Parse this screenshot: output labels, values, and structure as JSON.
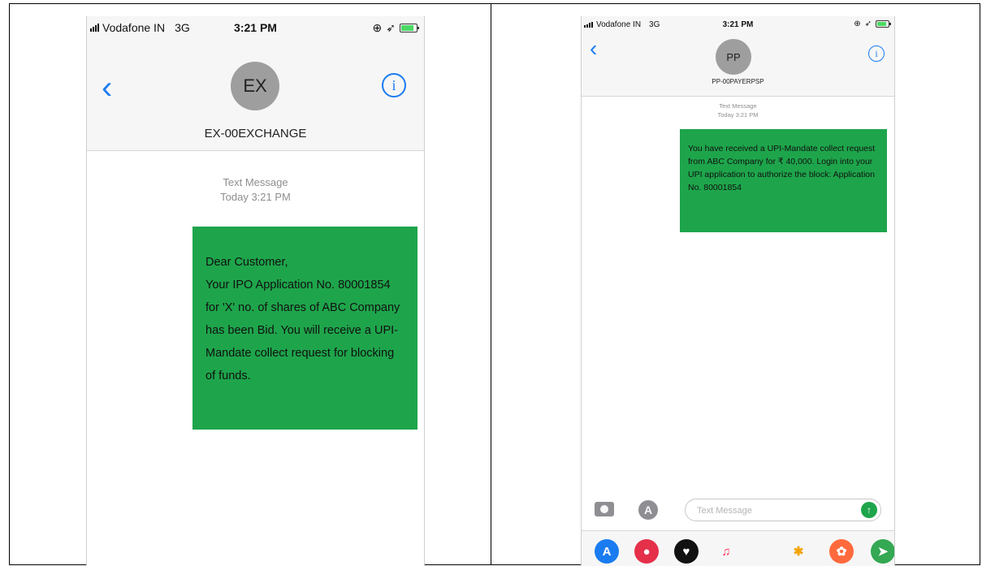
{
  "screen1": {
    "status": {
      "carrier": "Vodafone IN",
      "network": "3G",
      "time": "3:21 PM"
    },
    "contact": {
      "initials": "EX",
      "name": "EX-00EXCHANGE"
    },
    "message_meta": {
      "type": "Text Message",
      "time": "Today 3:21 PM"
    },
    "message": {
      "lines": [
        "Dear Customer,",
        "Your IPO Application No. 80001854 for 'X' no. of shares of ABC Company has been Bid. You will receive a UPI-Mandate collect request for blocking of funds."
      ],
      "bubble_color": "#1ea54b"
    }
  },
  "screen2": {
    "status": {
      "carrier": "Vodafone IN",
      "network": "3G",
      "time": "3:21 PM"
    },
    "contact": {
      "initials": "PP",
      "name": "PP-00PAYERPSP"
    },
    "message_meta": {
      "type": "Text Message",
      "time": "Today 3:21 PM"
    },
    "message": {
      "text": "You have received a UPI-Mandate collect request from ABC Company for ₹ 40,000. Login into your UPI application to authorize the block: Application No. 80001854",
      "bubble_color": "#1ea54b"
    },
    "compose": {
      "placeholder": "Text Message"
    },
    "app_drawer": [
      "app-store-icon",
      "search-images-icon",
      "digital-touch-icon",
      "music-icon",
      "photos-icon",
      "stickers-icon",
      "maps-icon"
    ]
  },
  "colors": {
    "ios_blue": "#1a7cf0",
    "avatar_gray": "#9e9e9e",
    "header_bg": "#f6f6f6"
  }
}
